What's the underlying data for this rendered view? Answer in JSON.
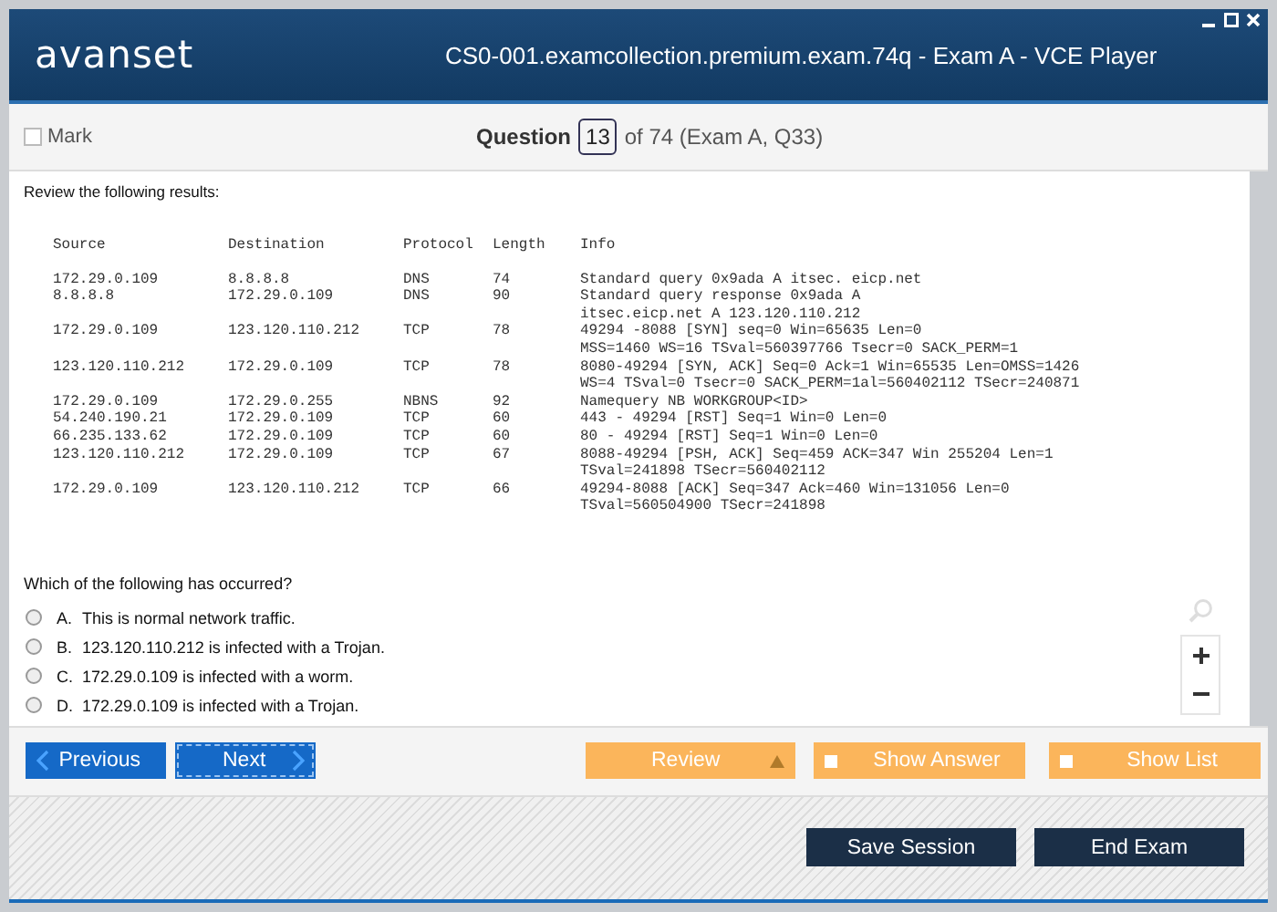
{
  "window": {
    "logo": "avanset",
    "title": "CS0-001.examcollection.premium.exam.74q - Exam A - VCE Player"
  },
  "header": {
    "mark": {
      "label": "Mark",
      "checked": false
    },
    "question_label": "Question",
    "question_number": "13",
    "question_of": "of 74 (Exam A, Q33)"
  },
  "question": {
    "intro": "Review the following results:",
    "table": {
      "columns": [
        "Source",
        "Destination",
        "Protocol",
        "Length",
        "Info"
      ],
      "rows": [
        {
          "source": "172.29.0.109",
          "destination": "8.8.8.8",
          "protocol": "DNS",
          "length": "74",
          "info": "Standard query 0x9ada A itsec. eicp.net"
        },
        {
          "source": "8.8.8.8",
          "destination": "172.29.0.109",
          "protocol": "DNS",
          "length": "90",
          "info": "Standard query response 0x9ada A\nitsec.eicp.net A 123.120.110.212"
        },
        {
          "source": "172.29.0.109",
          "destination": "123.120.110.212",
          "protocol": "TCP",
          "length": "78",
          "info": "49294 -8088 [SYN] seq=0 Win=65635 Len=0\nMSS=1460 WS=16 TSval=560397766 Tsecr=0 SACK_PERM=1"
        },
        {
          "source": "123.120.110.212",
          "destination": "172.29.0.109",
          "protocol": "TCP",
          "length": "78",
          "info": "8080-49294 [SYN, ACK] Seq=0 Ack=1 Win=65535 Len=OMSS=1426\nWS=4 TSval=0 Tsecr=0 SACK_PERM=1al=560402112 TSecr=240871"
        },
        {
          "source": "172.29.0.109",
          "destination": "172.29.0.255",
          "protocol": "NBNS",
          "length": "92",
          "info": "Namequery NB WORKGROUP<ID>"
        },
        {
          "source": "54.240.190.21",
          "destination": "172.29.0.109",
          "protocol": "TCP",
          "length": "60",
          "info": "443 - 49294 [RST] Seq=1 Win=0 Len=0"
        },
        {
          "source": "66.235.133.62",
          "destination": "172.29.0.109",
          "protocol": "TCP",
          "length": "60",
          "info": "80 - 49294 [RST] Seq=1 Win=0 Len=0"
        },
        {
          "source": "123.120.110.212",
          "destination": "172.29.0.109",
          "protocol": "TCP",
          "length": "67",
          "info": "8088-49294 [PSH, ACK] Seq=459 ACK=347 Win 255204 Len=1\nTSval=241898 TSecr=560402112"
        },
        {
          "source": "172.29.0.109",
          "destination": "123.120.110.212",
          "protocol": "TCP",
          "length": "66",
          "info": "49294-8088 [ACK] Seq=347 Ack=460 Win=131056 Len=0\nTSval=560504900 TSecr=241898"
        }
      ]
    },
    "prompt": "Which of the following has occurred?",
    "options": [
      {
        "letter": "A.",
        "text": "This is normal network traffic.",
        "selected": false
      },
      {
        "letter": "B.",
        "text": "123.120.110.212 is infected with a Trojan.",
        "selected": false
      },
      {
        "letter": "C.",
        "text": "172.29.0.109 is infected with a worm.",
        "selected": false
      },
      {
        "letter": "D.",
        "text": "172.29.0.109 is infected with a Trojan.",
        "selected": false
      }
    ]
  },
  "nav": {
    "previous": "Previous",
    "next": "Next",
    "review": "Review",
    "show_answer": {
      "label": "Show Answer",
      "checked": false
    },
    "show_list": {
      "label": "Show List",
      "checked": false
    }
  },
  "footer": {
    "save": "Save Session",
    "end": "End Exam"
  }
}
